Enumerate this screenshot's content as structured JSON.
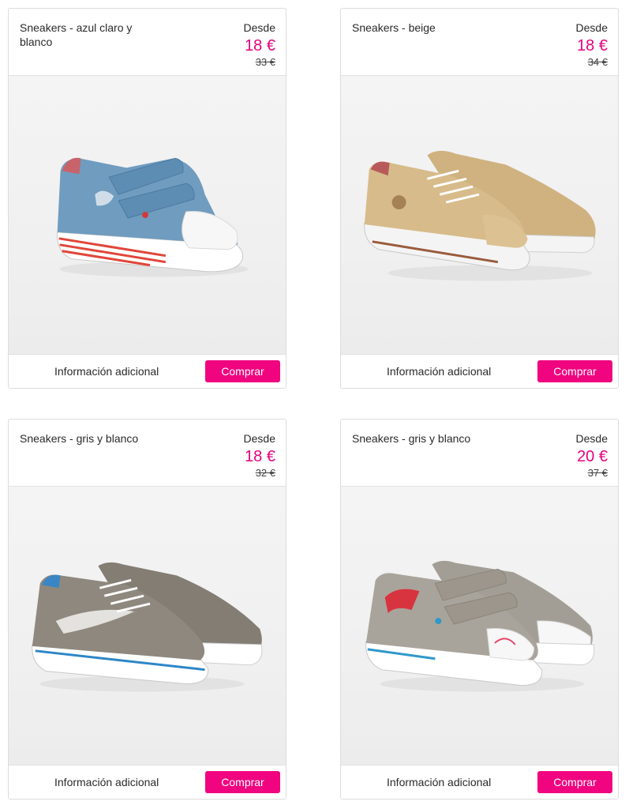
{
  "products": [
    {
      "title": "Sneakers - azul claro y blanco",
      "from_label": "Desde",
      "price": "18 €",
      "old_price": "33 €",
      "image_alt": "light blue and white sneaker",
      "colors": {
        "upper": "#6f9cbf",
        "sole": "#ffffff",
        "stripe": "#e0463a",
        "toe": "#f7f7f7"
      },
      "info_label": "Información adicional",
      "buy_label": "Comprar"
    },
    {
      "title": "Sneakers - beige",
      "from_label": "Desde",
      "price": "18 €",
      "old_price": "34 €",
      "image_alt": "beige sneakers pair",
      "colors": {
        "upper": "#d7bb8a",
        "sole": "#f4f4f4",
        "stripe": "#9a5b3b",
        "toe": "#d9bd8e"
      },
      "info_label": "Información adicional",
      "buy_label": "Comprar"
    },
    {
      "title": "Sneakers - gris y blanco",
      "from_label": "Desde",
      "price": "18 €",
      "old_price": "32 €",
      "image_alt": "grey and white sneakers pair",
      "colors": {
        "upper": "#8f887e",
        "sole": "#ffffff",
        "stripe": "#2d86c7",
        "toe": "#8f887e"
      },
      "info_label": "Información adicional",
      "buy_label": "Comprar"
    },
    {
      "title": "Sneakers - gris y blanco",
      "from_label": "Desde",
      "price": "20 €",
      "old_price": "37 €",
      "image_alt": "grey sneakers pair with red and blue details",
      "colors": {
        "upper": "#a9a49b",
        "sole": "#ffffff",
        "stripe": "#2f98c9",
        "toe": "#f7f7f7"
      },
      "info_label": "Información adicional",
      "buy_label": "Comprar"
    }
  ],
  "theme": {
    "accent": "#f0047f",
    "price_color": "#e5007d",
    "border": "#dcdcdc"
  }
}
